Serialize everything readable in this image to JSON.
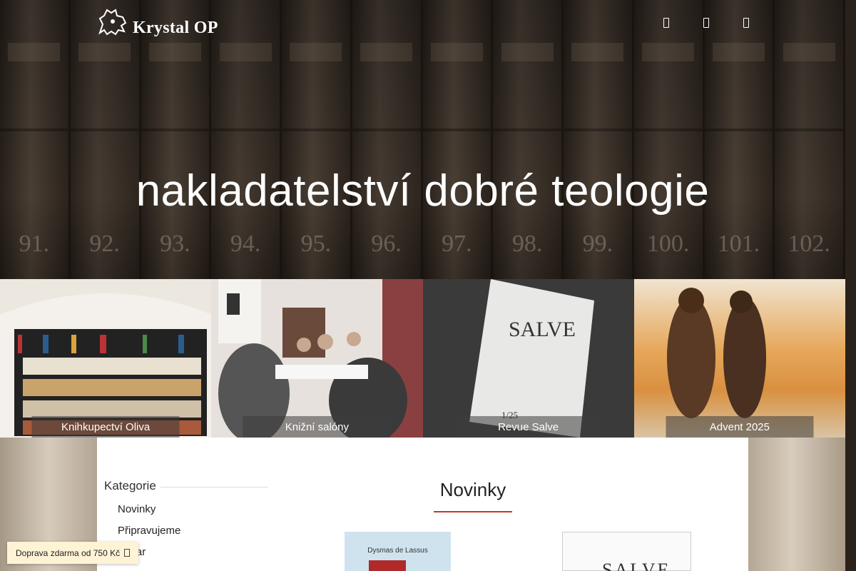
{
  "header": {
    "logo_text": "Krystal OP",
    "hero_title": "nakladatelství dobré teologie",
    "icons": [
      "user-icon",
      "search-icon",
      "cart-icon"
    ]
  },
  "hero_spine_numbers": [
    "91.",
    "92.",
    "93.",
    "94.",
    "95.",
    "96.",
    "97.",
    "98.",
    "99.",
    "100.",
    "101.",
    "102."
  ],
  "tiles": [
    {
      "label": "Knihkupectví Oliva"
    },
    {
      "label": "Knižní salóny"
    },
    {
      "label": "Revue Salve"
    },
    {
      "label": "Advent 2025"
    }
  ],
  "sidebar": {
    "title": "Kategorie",
    "items": [
      {
        "label": "Novinky"
      },
      {
        "label": "Připravujeme"
      },
      {
        "label": "Bazar"
      }
    ]
  },
  "main": {
    "section_title": "Novinky",
    "books": [
      {
        "author": "Dysmas de Lassus"
      },
      {
        "cover_text": "SALVE"
      }
    ]
  },
  "shipping_bar": {
    "text": "Doprava zdarma od 750 Kč"
  },
  "colors": {
    "accent": "#c0392b",
    "shipping_bg": "#fff3d6"
  }
}
